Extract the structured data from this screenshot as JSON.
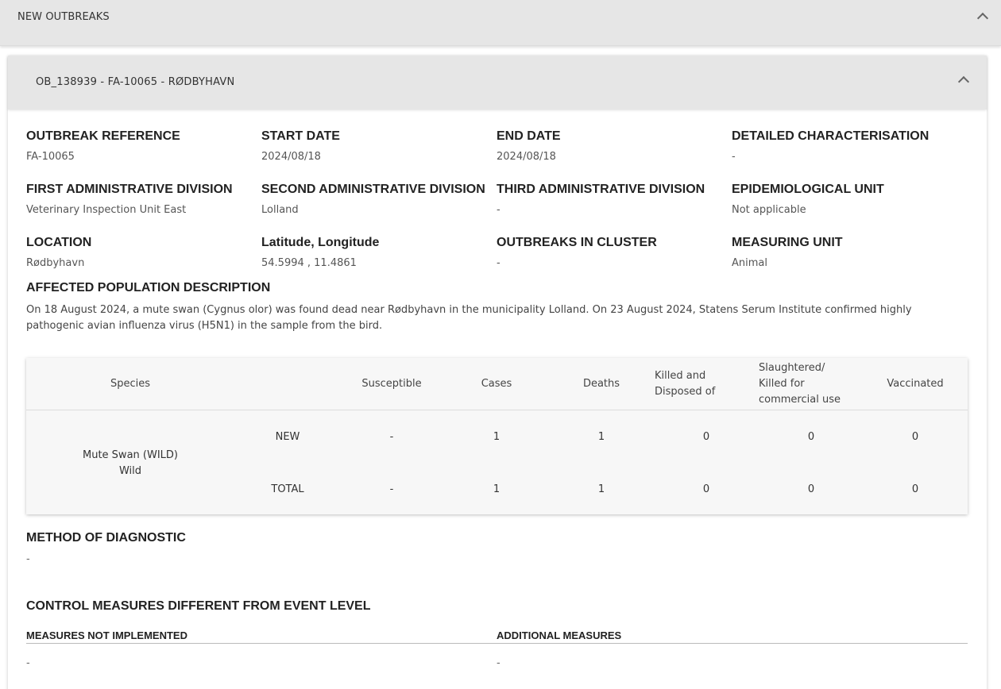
{
  "top_panel": {
    "title": "NEW OUTBREAKS"
  },
  "outbreak": {
    "header_title": "OB_138939 - FA-10065 - RØDBYHAVN",
    "fields": [
      {
        "label": "OUTBREAK REFERENCE",
        "value": "FA-10065"
      },
      {
        "label": "START DATE",
        "value": "2024/08/18"
      },
      {
        "label": "END DATE",
        "value": "2024/08/18"
      },
      {
        "label": "DETAILED CHARACTERISATION",
        "value": "-"
      },
      {
        "label": "FIRST ADMINISTRATIVE DIVISION",
        "value": "Veterinary Inspection Unit East"
      },
      {
        "label": "SECOND ADMINISTRATIVE DIVISION",
        "value": "Lolland"
      },
      {
        "label": "THIRD ADMINISTRATIVE DIVISION",
        "value": "-"
      },
      {
        "label": "EPIDEMIOLOGICAL UNIT",
        "value": "Not applicable"
      },
      {
        "label": "LOCATION",
        "value": "Rødbyhavn"
      },
      {
        "label": "Latitude, Longitude",
        "value": "54.5994 , 11.4861"
      },
      {
        "label": "OUTBREAKS IN CLUSTER",
        "value": "-"
      },
      {
        "label": "MEASURING UNIT",
        "value": "Animal"
      }
    ],
    "affected_population": {
      "label": "AFFECTED POPULATION DESCRIPTION",
      "text": "On 18 August 2024, a mute swan (Cygnus olor) was found dead near Rødbyhavn in the municipality Lolland. On 23 August 2024, Statens Serum Institute confirmed highly pathogenic avian influenza virus (H5N1) in the sample from the bird."
    },
    "table": {
      "headers": {
        "species": "Species",
        "susceptible": "Susceptible",
        "cases": "Cases",
        "deaths": "Deaths",
        "killed_line1": "Killed and",
        "killed_line2": "Disposed of",
        "slaughtered_line1": "Slaughtered/",
        "slaughtered_line2": "Killed for",
        "slaughtered_line3": "commercial use",
        "vaccinated": "Vaccinated"
      },
      "species_line1": "Mute Swan (WILD)",
      "species_line2": "Wild",
      "rows": [
        {
          "type": "NEW",
          "susceptible": "-",
          "cases": "1",
          "deaths": "1",
          "killed": "0",
          "slaughtered": "0",
          "vaccinated": "0"
        },
        {
          "type": "TOTAL",
          "susceptible": "-",
          "cases": "1",
          "deaths": "1",
          "killed": "0",
          "slaughtered": "0",
          "vaccinated": "0"
        }
      ]
    },
    "method_of_diagnostic": {
      "label": "METHOD OF DIAGNOSTIC",
      "value": "-"
    },
    "control_measures": {
      "label": "CONTROL MEASURES DIFFERENT FROM EVENT LEVEL",
      "not_implemented_label": "MEASURES NOT IMPLEMENTED",
      "not_implemented_value": "-",
      "additional_label": "ADDITIONAL MEASURES",
      "additional_value": "-"
    }
  }
}
